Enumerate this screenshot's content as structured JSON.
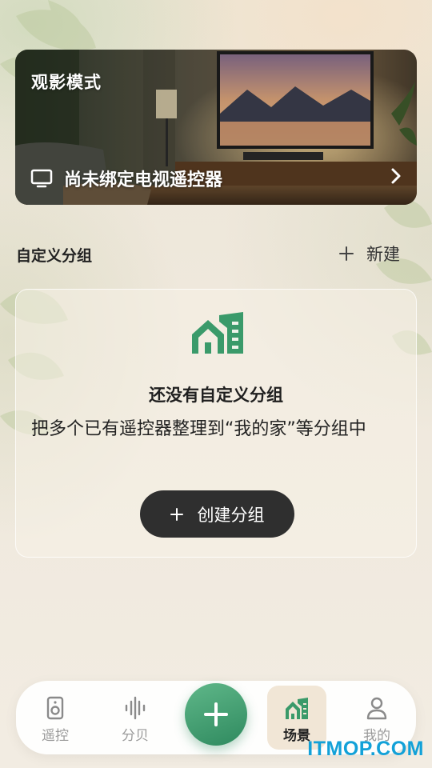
{
  "hero": {
    "title": "观影模式",
    "status_text": "尚未绑定电视遥控器",
    "icon": "tv-icon"
  },
  "groups_section": {
    "title": "自定义分组",
    "new_label": "新建"
  },
  "empty_state": {
    "icon": "buildings-icon",
    "title": "还没有自定义分组",
    "description": "把多个已有遥控器整理到“我的家”等分组中",
    "button_label": "创建分组"
  },
  "bottom_nav": {
    "items": [
      {
        "label": "遥控",
        "icon": "speaker-icon"
      },
      {
        "label": "分贝",
        "icon": "sound-wave-icon"
      },
      {
        "label": "",
        "icon": "plus-icon"
      },
      {
        "label": "场景",
        "icon": "buildings-icon",
        "active": true
      },
      {
        "label": "我的",
        "icon": "person-icon"
      }
    ]
  },
  "watermark": "ITMOP.COM",
  "colors": {
    "accent_green": "#3a9a6a",
    "dark_button": "#2f2f2f",
    "active_tab_bg": "#f1e6d6",
    "watermark_blue": "#12a1d8"
  }
}
